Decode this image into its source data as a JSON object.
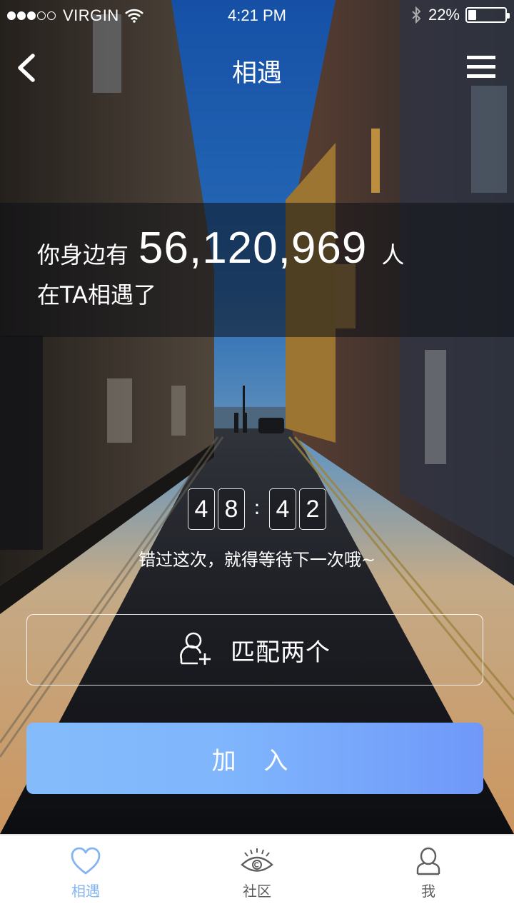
{
  "status_bar": {
    "signal_dots_filled": 3,
    "signal_dots_total": 5,
    "carrier": "VIRGIN",
    "time": "4:21 PM",
    "battery_percent_label": "22%",
    "battery_level": 0.22,
    "icons": [
      "signal-dots",
      "wifi-icon",
      "bluetooth-icon",
      "battery-icon"
    ]
  },
  "nav": {
    "title": "相遇",
    "back_icon": "chevron-left-icon",
    "menu_icon": "hamburger-menu-icon"
  },
  "banner": {
    "prefix": "你身边有",
    "count": "56,120,969",
    "suffix": "人",
    "line2": "在TA相遇了"
  },
  "countdown": {
    "digits": [
      "4",
      "8",
      "4",
      "2"
    ],
    "separator": ":",
    "hint": "错过这次，就得等待下一次哦~"
  },
  "match_button": {
    "label": "匹配两个",
    "icon": "add-user-icon"
  },
  "join_button": {
    "label": "加 入",
    "gradient_start": "#84bcfb",
    "gradient_end": "#6f98fa"
  },
  "tabbar": {
    "tabs": [
      {
        "label": "相遇",
        "icon": "heart-icon",
        "active": true
      },
      {
        "label": "社区",
        "icon": "eye-icon",
        "active": false
      },
      {
        "label": "我",
        "icon": "person-icon",
        "active": false
      }
    ],
    "active_color": "#84b4f3",
    "inactive_color": "#5d5d5d"
  }
}
